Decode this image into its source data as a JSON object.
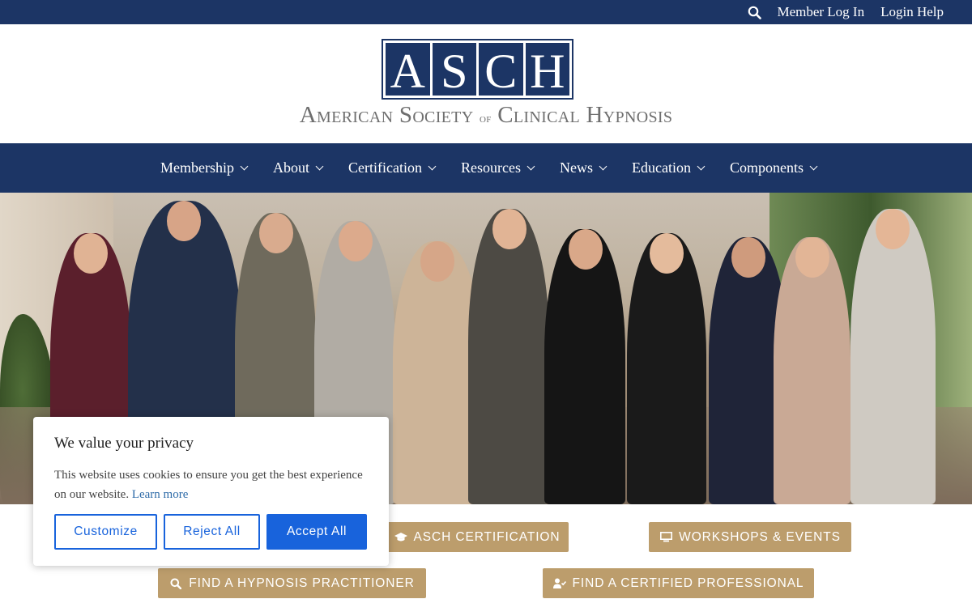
{
  "topbar": {
    "icon": "search-icon",
    "links": [
      "Member Log In",
      "Login Help"
    ]
  },
  "logo": {
    "letters": [
      "A",
      "S",
      "C",
      "H"
    ],
    "sub_first": "A",
    "sub_word1": "merican",
    "sub_s": "S",
    "sub_word2": "ociety",
    "sub_of": "of",
    "sub_c": "C",
    "sub_word3": "linical",
    "sub_h": "H",
    "sub_word4": "ypnosis"
  },
  "nav": {
    "items": [
      "Membership",
      "About",
      "Certification",
      "Resources",
      "News",
      "Education",
      "Components"
    ]
  },
  "hero": {
    "alt_icon": "photo-group-icon"
  },
  "ctas": {
    "certification": "ASCH CERTIFICATION",
    "workshops": "WORKSHOPS & EVENTS",
    "find_practitioner": "FIND A HYPNOSIS PRACTITIONER",
    "find_certified": "FIND A CERTIFIED PROFESSIONAL"
  },
  "cookie": {
    "title": "We value your privacy",
    "body": "This website uses cookies to ensure you get the best experience on our website.",
    "learn_more": "Learn more",
    "customize": "Customize",
    "reject": "Reject All",
    "accept": "Accept All"
  },
  "colors": {
    "navy": "#1c3565",
    "tan": "#bc9d6c",
    "cookie_blue": "#1863dc"
  }
}
